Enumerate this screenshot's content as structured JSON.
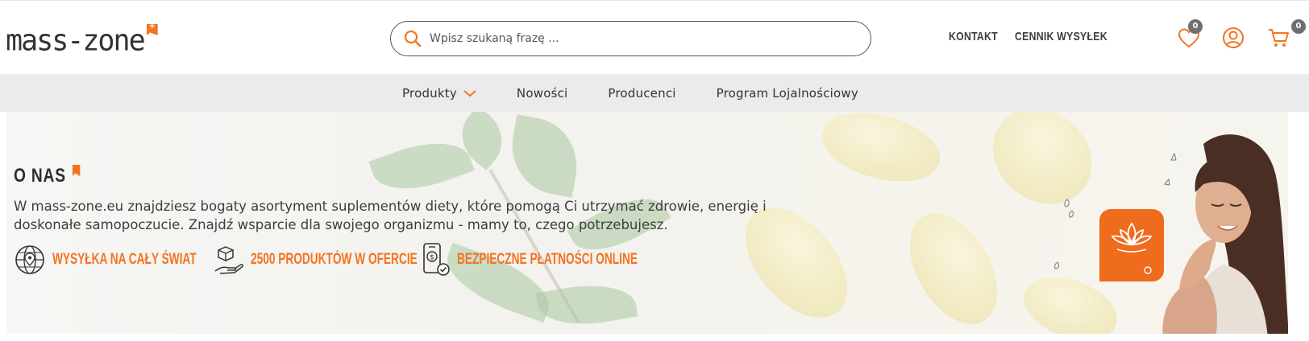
{
  "header": {
    "logo_text": "mass-zone",
    "logo_badge": "+",
    "search_placeholder": "Wpisz szukaną frazę ...",
    "links": [
      "KONTAKT",
      "CENNIK WYSYŁEK"
    ],
    "wishlist_count": "0",
    "cart_count": "0"
  },
  "nav": {
    "items": [
      "Produkty",
      "Nowości",
      "Producenci",
      "Program Lojalnościowy"
    ]
  },
  "hero": {
    "title": "O NAS",
    "text_line1": "W mass-zone.eu znajdziesz bogaty asortyment suplementów diety, które pomogą Ci utrzymać zdrowie, energię i",
    "text_line2": "doskonałe samopoczucie. Znajdź wsparcie dla swojego organizmu - mamy to, czego potrzebujesz.",
    "features": [
      "WYSYŁKA NA CAŁY ŚWIAT",
      "2500 PRODUKTÓW W OFERCIE",
      "BEZPIECZNE PŁATNOŚCI ONLINE"
    ]
  },
  "colors": {
    "accent": "#f47321",
    "nav_bg": "#ebebeb",
    "text": "#3d3d3d"
  },
  "icons": [
    "search-icon",
    "heart-icon",
    "user-icon",
    "cart-icon",
    "chevron-down-icon",
    "globe-icon",
    "box-hand-icon",
    "phone-payment-icon",
    "lotus-icon"
  ]
}
